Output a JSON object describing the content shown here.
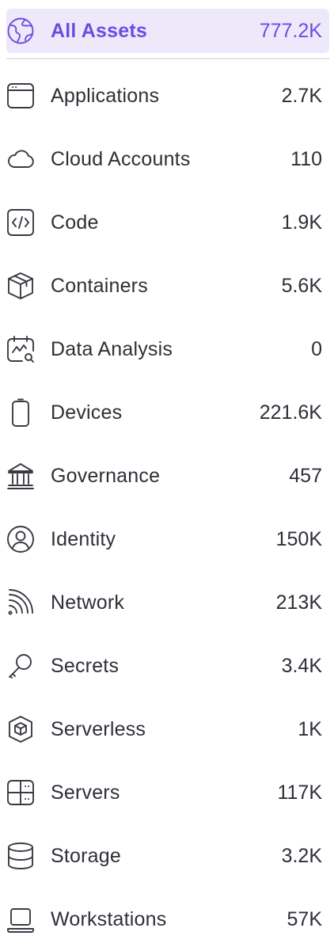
{
  "asset_nav": {
    "all": {
      "label": "All Assets",
      "count": "777.2K",
      "icon": "globe-icon"
    },
    "items": [
      {
        "label": "Applications",
        "count": "2.7K",
        "icon": "browser-window-icon"
      },
      {
        "label": "Cloud Accounts",
        "count": "110",
        "icon": "cloud-icon"
      },
      {
        "label": "Code",
        "count": "1.9K",
        "icon": "code-icon"
      },
      {
        "label": "Containers",
        "count": "5.6K",
        "icon": "box-icon"
      },
      {
        "label": "Data Analysis",
        "count": "0",
        "icon": "calendar-chart-icon"
      },
      {
        "label": "Devices",
        "count": "221.6K",
        "icon": "phone-icon"
      },
      {
        "label": "Governance",
        "count": "457",
        "icon": "bank-icon"
      },
      {
        "label": "Identity",
        "count": "150K",
        "icon": "user-circle-icon"
      },
      {
        "label": "Network",
        "count": "213K",
        "icon": "wifi-signal-icon"
      },
      {
        "label": "Secrets",
        "count": "3.4K",
        "icon": "key-icon"
      },
      {
        "label": "Serverless",
        "count": "1K",
        "icon": "hexagon-box-icon"
      },
      {
        "label": "Servers",
        "count": "117K",
        "icon": "server-icon"
      },
      {
        "label": "Storage",
        "count": "3.2K",
        "icon": "database-icon"
      },
      {
        "label": "Workstations",
        "count": "57K",
        "icon": "laptop-icon"
      }
    ],
    "colors": {
      "accent": "#6d4ce0",
      "active_bg": "#ede9fb",
      "text": "#2f2f38",
      "divider": "#e4e4e8"
    }
  }
}
